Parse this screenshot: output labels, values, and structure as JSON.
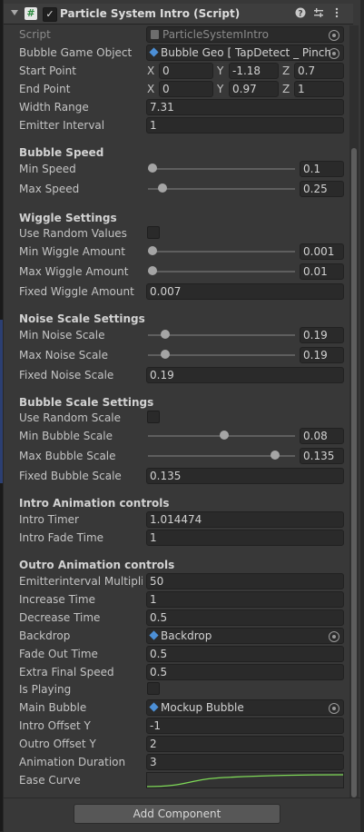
{
  "component": {
    "title": "Particle System Intro (Script)",
    "enabled_mark": "✓",
    "script_glyph": "#"
  },
  "fields": {
    "script": {
      "label": "Script",
      "value": "ParticleSystemIntro"
    },
    "bubble_game_object": {
      "label": "Bubble Game Object",
      "value": "Bubble Geo [ TapDetect _ Pinch"
    },
    "start_point": {
      "label": "Start Point",
      "x": "0",
      "y": "-1.18",
      "z": "0.7"
    },
    "end_point": {
      "label": "End Point",
      "x": "0",
      "y": "0.97",
      "z": "1"
    },
    "width_range": {
      "label": "Width Range",
      "value": "7.31"
    },
    "emitter_interval": {
      "label": "Emitter Interval",
      "value": "1"
    }
  },
  "axes": {
    "x": "X",
    "y": "Y",
    "z": "Z"
  },
  "bubble_speed": {
    "title": "Bubble Speed",
    "min": {
      "label": "Min Speed",
      "value": "0.1",
      "fraction": 0.0
    },
    "max": {
      "label": "Max Speed",
      "value": "0.25",
      "fraction": 0.07
    }
  },
  "wiggle": {
    "title": "Wiggle Settings",
    "use_random": {
      "label": "Use Random Values",
      "checked": false
    },
    "min": {
      "label": "Min Wiggle Amount",
      "value": "0.001",
      "fraction": 0.0
    },
    "max": {
      "label": "Max Wiggle Amount",
      "value": "0.01",
      "fraction": 0.0
    },
    "fixed": {
      "label": "Fixed Wiggle Amount",
      "value": "0.007"
    }
  },
  "noise": {
    "title": "Noise Scale Settings",
    "min": {
      "label": "Min Noise Scale",
      "value": "0.19",
      "fraction": 0.09
    },
    "max": {
      "label": "Max Noise Scale",
      "value": "0.19",
      "fraction": 0.09
    },
    "fixed": {
      "label": "Fixed Noise Scale",
      "value": "0.19"
    }
  },
  "bubble_scale": {
    "title": "Bubble Scale Settings",
    "use_random": {
      "label": "Use Random Scale",
      "checked": false
    },
    "min": {
      "label": "Min Bubble Scale",
      "value": "0.08",
      "fraction": 0.52
    },
    "max": {
      "label": "Max Bubble Scale",
      "value": "0.135",
      "fraction": 0.89
    },
    "fixed": {
      "label": "Fixed Bubble Scale",
      "value": "0.135"
    }
  },
  "intro": {
    "title": "Intro Animation controls",
    "timer": {
      "label": "Intro Timer",
      "value": "1.014474"
    },
    "fade": {
      "label": "Intro Fade Time",
      "value": "1"
    }
  },
  "outro": {
    "title": "Outro Animation controls",
    "emitter_multiplier": {
      "label": "Emitterinterval Multiplier",
      "value": "50"
    },
    "increase": {
      "label": "Increase Time",
      "value": "1"
    },
    "decrease": {
      "label": "Decrease Time",
      "value": "0.5"
    },
    "backdrop": {
      "label": "Backdrop",
      "value": "Backdrop"
    },
    "fade_out": {
      "label": "Fade Out Time",
      "value": "0.5"
    },
    "extra_speed": {
      "label": "Extra Final Speed",
      "value": "0.5"
    },
    "is_playing": {
      "label": "Is Playing",
      "checked": false
    },
    "main_bubble": {
      "label": "Main Bubble",
      "value": "Mockup Bubble"
    },
    "intro_offset": {
      "label": "Intro Offset Y",
      "value": "-1"
    },
    "outro_offset": {
      "label": "Outro Offset Y",
      "value": "2"
    },
    "duration": {
      "label": "Animation Duration",
      "value": "3"
    },
    "ease": {
      "label": "Ease Curve",
      "curve_color": "#7ed957"
    }
  },
  "footer": {
    "add_component": "Add Component"
  }
}
